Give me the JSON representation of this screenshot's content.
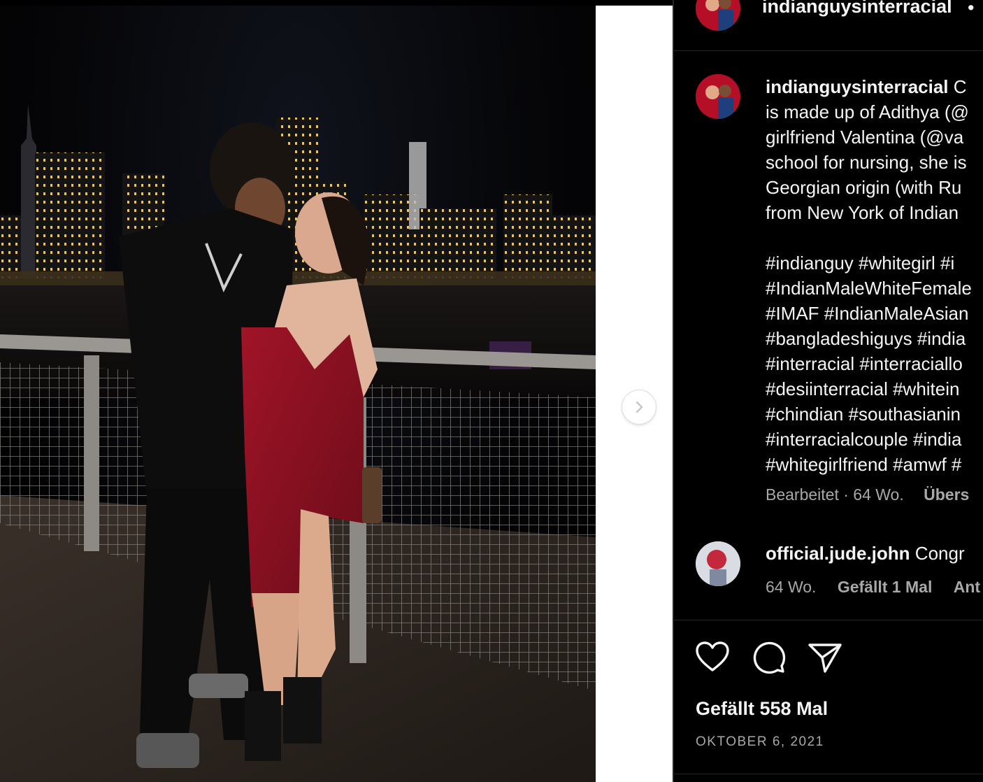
{
  "post": {
    "username": "indianguysinterracial",
    "header_separator": "•",
    "caption_lines": [
      "C",
      "is made up of Adithya (@",
      "girlfriend Valentina (@va",
      "school for nursing, she is",
      "Georgian origin (with Ru",
      "from New York of Indian"
    ],
    "hashtag_lines": [
      "#indianguy #whitegirl #i",
      "#IndianMaleWhiteFemale",
      "#IMAF #IndianMaleAsian",
      "#bangladeshiguys #india",
      "#interracial #interraciallo",
      "#desiinterracial #whitein",
      "#chindian #southasianin",
      "#interracialcouple #india",
      "#whitegirlfriend #amwf #"
    ],
    "caption_meta": "Bearbeitet · 64 Wo.",
    "translate_label": "Übers",
    "comment": {
      "username": "official.jude.john",
      "text": "Congr",
      "age": "64 Wo.",
      "likes": "Gefällt 1 Mal",
      "reply": "Ant"
    },
    "likes_label": "Gefällt 558 Mal",
    "date": "OKTOBER 6, 2021"
  },
  "icons": {
    "like": "heart-icon",
    "comment": "comment-icon",
    "share": "send-icon",
    "next": "chevron-right-icon"
  },
  "colors": {
    "background": "#000000",
    "text": "#f5f5f5",
    "secondary_text": "#a8a8a8",
    "divider": "#262626",
    "dress": "#8b1021"
  }
}
